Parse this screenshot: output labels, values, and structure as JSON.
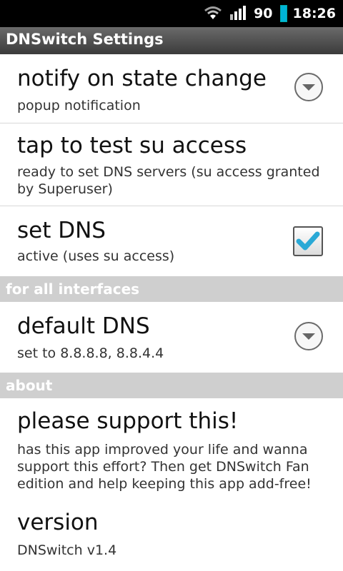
{
  "statusbar": {
    "battery_level": "90",
    "time": "18:26",
    "icons": [
      "wifi-icon",
      "signal-icon",
      "battery-icon"
    ]
  },
  "titlebar": {
    "title": "DNSwitch Settings"
  },
  "prefs": {
    "notify": {
      "title": "notify on state change",
      "summary": "popup notification"
    },
    "test_su": {
      "title": "tap to test su access",
      "summary": "ready to set DNS servers (su access granted by Superuser)"
    },
    "set_dns": {
      "title": "set DNS",
      "summary": "active (uses su access)",
      "checked": true
    },
    "category_interfaces": "for all interfaces",
    "default_dns": {
      "title": "default DNS",
      "summary": "set to 8.8.8.8, 8.8.4.4"
    },
    "category_about": "about",
    "support": {
      "title": "please support this!",
      "summary": "has this app improved your life and wanna support this effort? Then get DNSwitch Fan edition and help keeping this app add-free!"
    },
    "version": {
      "title": "version",
      "summary": "DNSwitch v1.4"
    }
  },
  "colors": {
    "check_accent": "#2aa9d6",
    "battery": "#00b4d8",
    "category_bg": "#cfcfcf"
  }
}
